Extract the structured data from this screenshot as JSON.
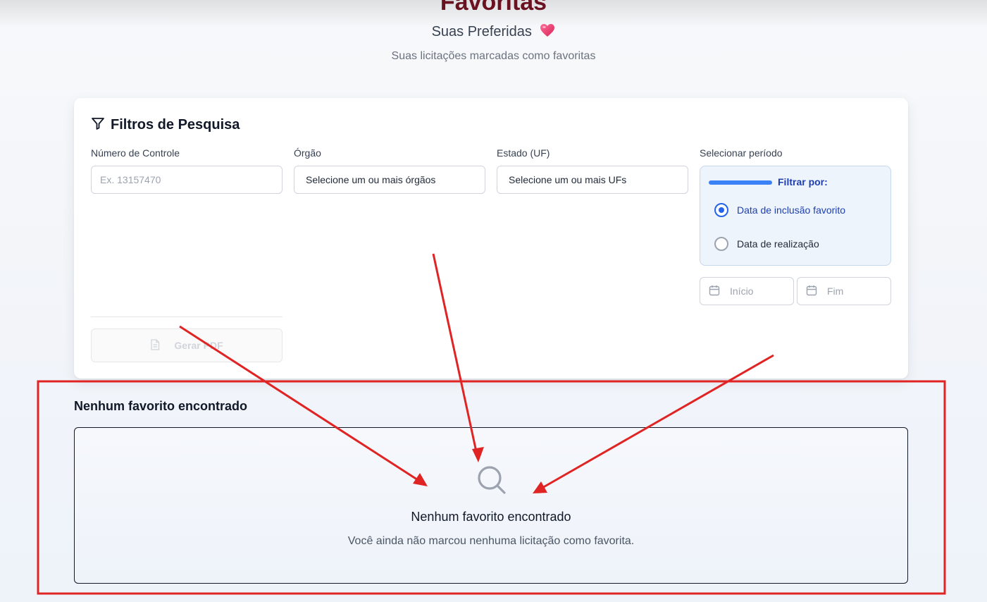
{
  "header": {
    "title": "Favoritas",
    "subtitle": "Suas Preferidas",
    "description": "Suas licitações marcadas como favoritas"
  },
  "filters": {
    "title": "Filtros de Pesquisa",
    "control_number": {
      "label": "Número de Controle",
      "placeholder": "Ex. 13157470"
    },
    "agency": {
      "label": "Órgão",
      "value": "Selecione um ou mais órgãos"
    },
    "state": {
      "label": "Estado (UF)",
      "value": "Selecione um ou mais UFs"
    },
    "period": {
      "label": "Selecionar período",
      "filter_by": "Filtrar por:",
      "options": [
        {
          "label": "Data de inclusão favorito",
          "selected": true
        },
        {
          "label": "Data de realização",
          "selected": false
        }
      ],
      "start_placeholder": "Início",
      "end_placeholder": "Fim"
    },
    "pdf_button": "Gerar PDF"
  },
  "results": {
    "title": "Nenhum favorito encontrado",
    "empty_title": "Nenhum favorito encontrado",
    "empty_description": "Você ainda não marcou nenhuma licitação como favorita."
  },
  "colors": {
    "title": "#6b1220",
    "accent": "#2563eb",
    "annotation": "#e02424"
  }
}
